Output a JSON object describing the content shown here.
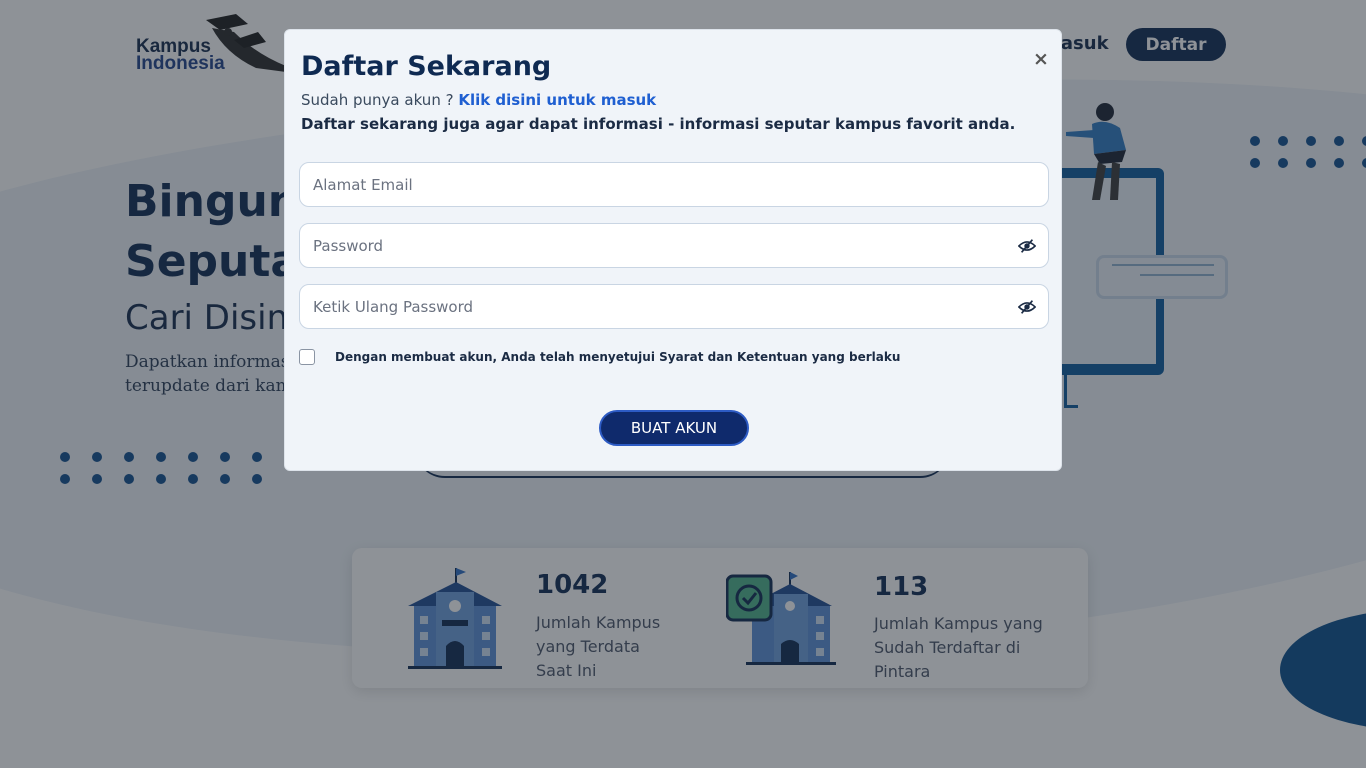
{
  "nav": {
    "logo_line1": "Kampus",
    "logo_line2": "Indonesia",
    "masuk_label": "Masuk",
    "daftar_label": "Daftar"
  },
  "hero": {
    "title_line1": "Bingung",
    "title_line2": "Seputar",
    "subtitle": "Cari Disini",
    "desc_line1": "Dapatkan informasi",
    "desc_line2": "terupdate dari kami"
  },
  "stats": [
    {
      "number": "1042",
      "label": "Jumlah Kampus yang Terdata Saat Ini"
    },
    {
      "number": "113",
      "label": "Jumlah Kampus yang Sudah Terdaftar di Pintara"
    }
  ],
  "modal": {
    "title": "Daftar Sekarang",
    "close_label": "×",
    "login_prompt": "Sudah punya akun ? ",
    "login_link": "Klik disini untuk masuk",
    "description": "Daftar sekarang juga agar dapat informasi - informasi seputar kampus favorit anda.",
    "email_placeholder": "Alamat Email",
    "password_placeholder": "Password",
    "confirm_placeholder": "Ketik Ulang Password",
    "agree_text": "Dengan membuat akun, Anda telah menyetujui Syarat dan Ketentuan yang berlaku",
    "submit_label": "BUAT AKUN"
  },
  "icons": {
    "eye": "eye-slash-icon",
    "close": "close-icon",
    "school": "school-building-icon",
    "verified_school": "verified-school-icon"
  },
  "colors": {
    "primary": "#0f2a52",
    "link": "#1f5fd1",
    "button": "#0f2a6c",
    "accent_blue": "#0c5a9c",
    "modal_bg": "#f0f4f9"
  }
}
